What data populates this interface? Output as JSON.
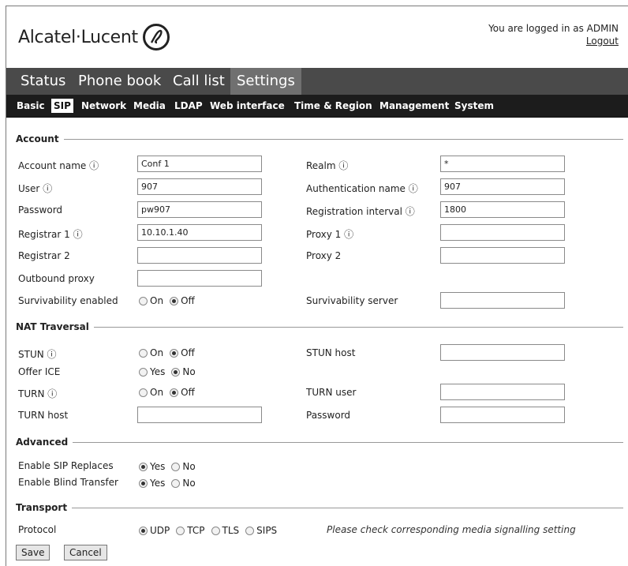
{
  "header": {
    "logo_text": "Alcatel·Lucent",
    "login_text": "You are logged in as ADMIN",
    "logout_label": "Logout"
  },
  "main_nav": [
    "Status",
    "Phone book",
    "Call list",
    "Settings"
  ],
  "main_nav_active": "Settings",
  "sub_nav": [
    "Basic",
    "SIP",
    "Network",
    "Media",
    "LDAP",
    "Web interface",
    "Time & Region",
    "Management",
    "System"
  ],
  "sub_nav_active": "SIP",
  "info_icon": "ⓘ",
  "account": {
    "title": "Account",
    "account_name_label": "Account name",
    "account_name_value": "Conf 1",
    "realm_label": "Realm",
    "realm_value": "*",
    "user_label": "User",
    "user_value": "907",
    "auth_name_label": "Authentication name",
    "auth_name_value": "907",
    "password_label": "Password",
    "password_value": "pw907",
    "reg_interval_label": "Registration interval",
    "reg_interval_value": "1800",
    "registrar1_label": "Registrar 1",
    "registrar1_value": "10.10.1.40",
    "proxy1_label": "Proxy 1",
    "proxy1_value": "",
    "registrar2_label": "Registrar 2",
    "registrar2_value": "",
    "proxy2_label": "Proxy 2",
    "proxy2_value": "",
    "outbound_proxy_label": "Outbound proxy",
    "outbound_proxy_value": "",
    "survivability_label": "Survivability enabled",
    "survivability_on": "On",
    "survivability_off": "Off",
    "survivability_selected": "Off",
    "survivability_server_label": "Survivability server",
    "survivability_server_value": ""
  },
  "nat": {
    "title": "NAT Traversal",
    "stun_label": "STUN",
    "stun_on": "On",
    "stun_off": "Off",
    "stun_selected": "Off",
    "stun_host_label": "STUN host",
    "stun_host_value": "",
    "offer_ice_label": "Offer ICE",
    "offer_ice_yes": "Yes",
    "offer_ice_no": "No",
    "offer_ice_selected": "No",
    "turn_label": "TURN",
    "turn_on": "On",
    "turn_off": "Off",
    "turn_selected": "Off",
    "turn_user_label": "TURN user",
    "turn_user_value": "",
    "turn_host_label": "TURN host",
    "turn_host_value": "",
    "turn_password_label": "Password",
    "turn_password_value": ""
  },
  "advanced": {
    "title": "Advanced",
    "sip_replaces_label": "Enable SIP Replaces",
    "sip_replaces_yes": "Yes",
    "sip_replaces_no": "No",
    "sip_replaces_selected": "Yes",
    "blind_transfer_label": "Enable Blind Transfer",
    "blind_transfer_yes": "Yes",
    "blind_transfer_no": "No",
    "blind_transfer_selected": "Yes"
  },
  "transport": {
    "title": "Transport",
    "protocol_label": "Protocol",
    "options": [
      "UDP",
      "TCP",
      "TLS",
      "SIPS"
    ],
    "selected": "UDP",
    "note": "Please check corresponding media signalling setting"
  },
  "buttons": {
    "save": "Save",
    "cancel": "Cancel"
  }
}
